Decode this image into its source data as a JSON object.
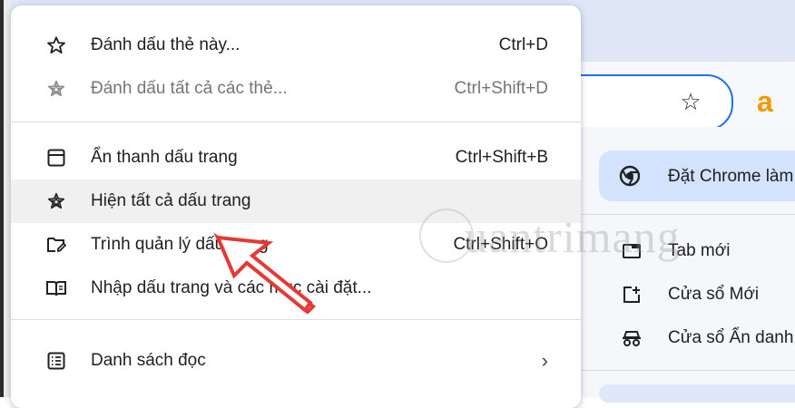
{
  "menu": {
    "items": [
      {
        "label": "Đánh dấu thẻ này...",
        "shortcut": "Ctrl+D"
      },
      {
        "label": "Đánh dấu tất cả các thẻ...",
        "shortcut": "Ctrl+Shift+D"
      },
      {
        "label": "Ẩn thanh dấu trang",
        "shortcut": "Ctrl+Shift+B"
      },
      {
        "label": "Hiện tất cả dấu trang",
        "shortcut": ""
      },
      {
        "label": "Trình quản lý dấu trang",
        "shortcut": "Ctrl+Shift+O"
      },
      {
        "label": "Nhập dấu trang và các mục cài đặt...",
        "shortcut": ""
      },
      {
        "label": "Danh sách đọc",
        "shortcut": ""
      }
    ]
  },
  "right_panel": {
    "default_browser": "Đặt Chrome làm",
    "items": [
      {
        "label": "Tab mới"
      },
      {
        "label": "Cửa sổ Mới"
      },
      {
        "label": "Cửa sổ Ẩn danh"
      }
    ]
  },
  "toolbar": {
    "extension_letter": "a"
  },
  "watermark": "uantrimang",
  "colors": {
    "accent": "#1a73e8",
    "annotation": "#e53935",
    "highlight": "#f0f0f0"
  }
}
